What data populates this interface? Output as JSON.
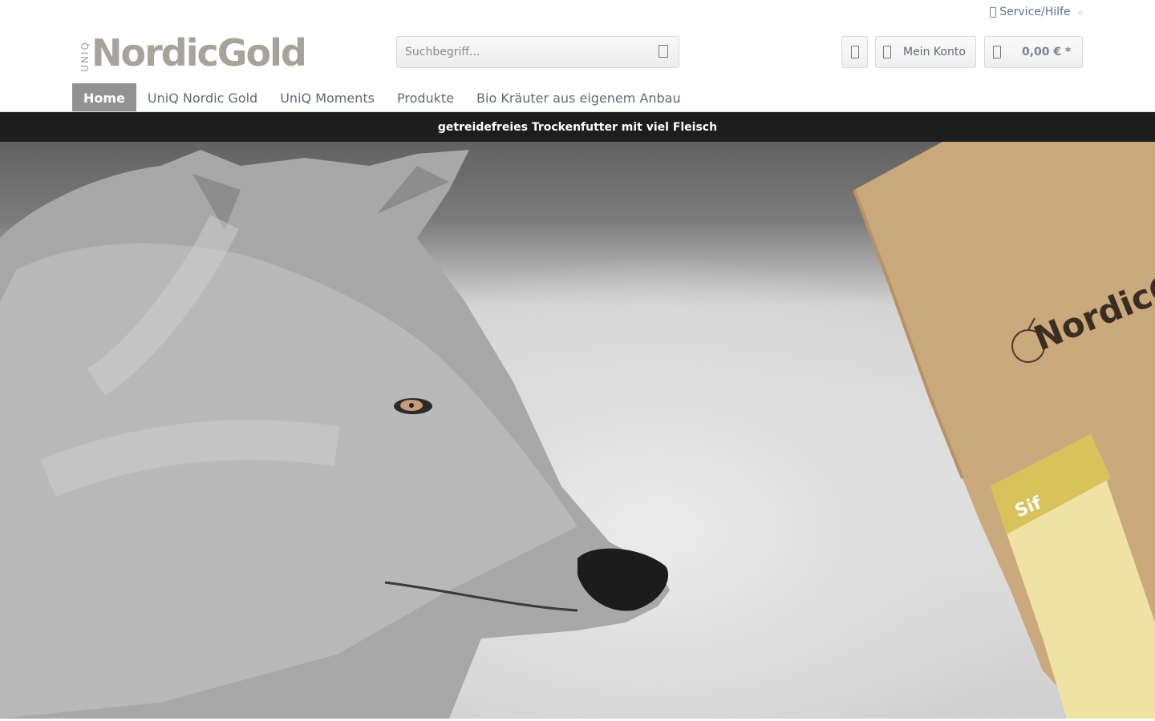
{
  "service": {
    "label": "Service/Hilfe"
  },
  "logo": {
    "prefix": "UNIQ",
    "name": "NordicGold"
  },
  "search": {
    "placeholder": "Suchbegriff..."
  },
  "account": {
    "label": "Mein Konto"
  },
  "cart": {
    "label": "0,00 € *"
  },
  "nav": {
    "items": [
      {
        "label": "Home",
        "active": true
      },
      {
        "label": "UniQ Nordic Gold",
        "active": false
      },
      {
        "label": "UniQ Moments",
        "active": false
      },
      {
        "label": "Produkte",
        "active": false
      },
      {
        "label": "Bio Kräuter aus eigenem Anbau",
        "active": false
      }
    ]
  },
  "hero": {
    "banner_text": "getreidefreies Trockenfutter mit viel Fleisch",
    "bag_brand": "NordicG",
    "bag_label": "Sif"
  },
  "colors": {
    "accent_nav": "#929292",
    "logo": "#a7a29a",
    "bag": "#caa97c",
    "banner": "#141414"
  }
}
